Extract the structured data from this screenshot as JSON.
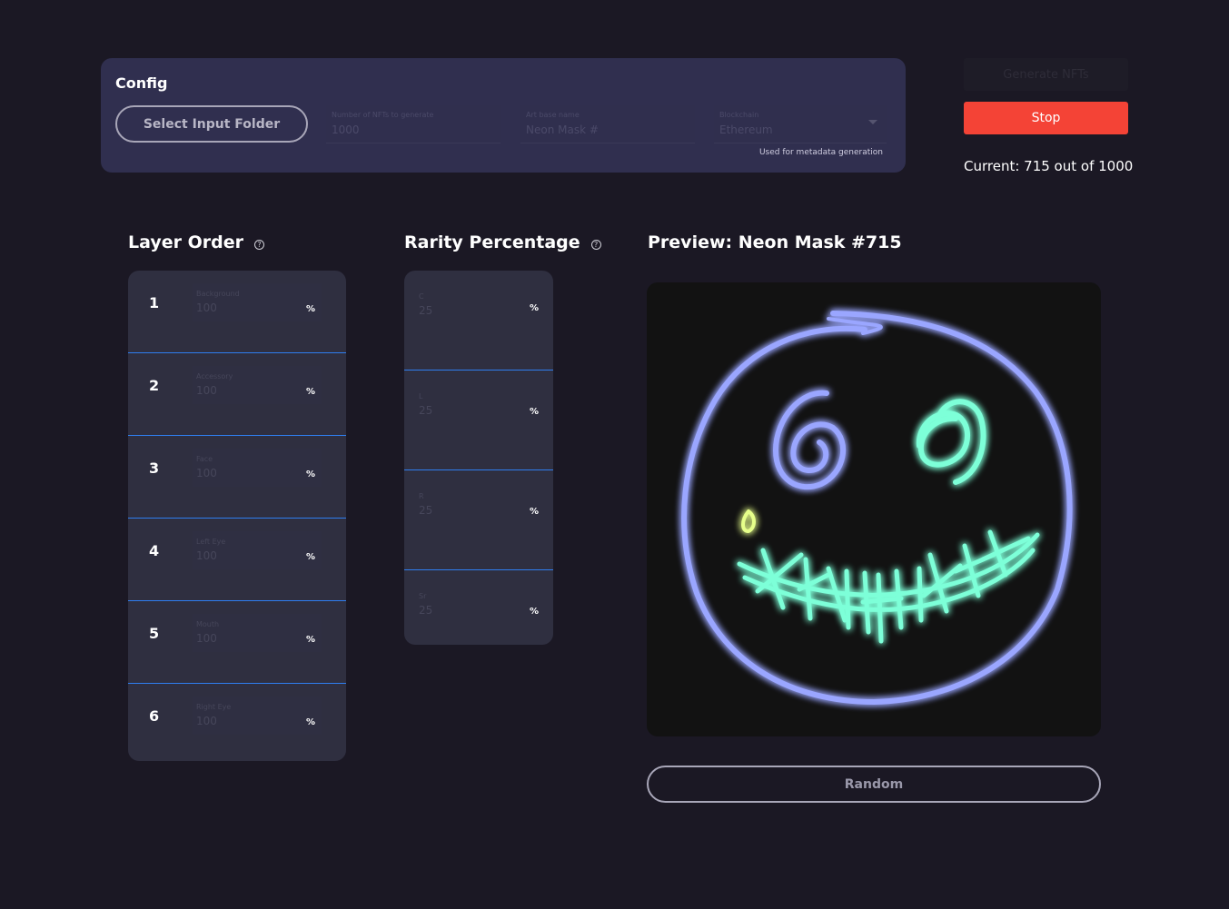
{
  "config": {
    "title": "Config",
    "select_folder_label": "Select Input Folder",
    "num_nfts_label": "Number of NFTs to generate",
    "num_nfts_value": "1000",
    "art_base_label": "Art base name",
    "art_base_value": "Neon Mask #",
    "blockchain_label": "Blockchain",
    "blockchain_value": "Ethereum",
    "helper_text": "Used for metadata generation"
  },
  "actions": {
    "generate_label": "Generate NFTs",
    "stop_label": "Stop",
    "progress_text": "Current: 715 out of 1000",
    "progress": {
      "current": 715,
      "total": 1000
    }
  },
  "layer_order": {
    "title": "Layer Order",
    "help": "?",
    "layers": [
      {
        "num": "1",
        "name": "Background",
        "value": "100",
        "unit": "%"
      },
      {
        "num": "2",
        "name": "Accessory",
        "value": "100",
        "unit": "%"
      },
      {
        "num": "3",
        "name": "Face",
        "value": "100",
        "unit": "%"
      },
      {
        "num": "4",
        "name": "Left Eye",
        "value": "100",
        "unit": "%"
      },
      {
        "num": "5",
        "name": "Mouth",
        "value": "100",
        "unit": "%"
      },
      {
        "num": "6",
        "name": "Right Eye",
        "value": "100",
        "unit": "%"
      }
    ]
  },
  "rarity": {
    "title": "Rarity Percentage",
    "help": "?",
    "items": [
      {
        "name": "C",
        "value": "25",
        "unit": "%"
      },
      {
        "name": "L",
        "value": "25",
        "unit": "%"
      },
      {
        "name": "R",
        "value": "25",
        "unit": "%"
      },
      {
        "name": "Sr",
        "value": "25",
        "unit": "%"
      }
    ]
  },
  "preview": {
    "title": "Preview: Neon Mask #715",
    "random_label": "Random"
  },
  "colors": {
    "background": "#1b1824",
    "config_card": "#302f4f",
    "stop": "#f44336",
    "divider": "#2f7ef0",
    "neon_blue": "#9aa6ff",
    "neon_green": "#7dffd8",
    "neon_yellow": "#e6ff8a"
  }
}
